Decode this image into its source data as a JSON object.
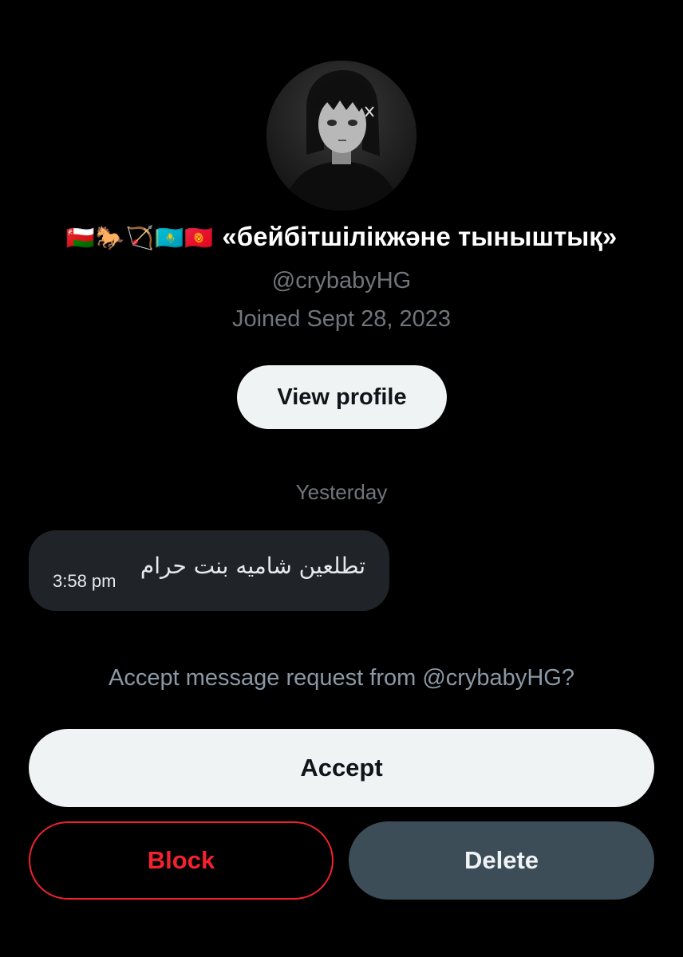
{
  "profile": {
    "avatar_icon": "anime-girl-avatar",
    "flags": "🇴🇲🐎🏹🇰🇿🇰🇬",
    "display_name": "«бейбітшілікжәне тыныштық»",
    "handle": "@crybabyHG",
    "joined": "Joined Sept 28, 2023",
    "view_profile_label": "View profile"
  },
  "conversation": {
    "day_divider": "Yesterday",
    "messages": [
      {
        "text": "تطلعين شاميه بنت حرام",
        "time": "3:58 pm"
      }
    ]
  },
  "request": {
    "prompt": "Accept message request from @crybabyHG?",
    "accept_label": "Accept",
    "block_label": "Block",
    "delete_label": "Delete"
  },
  "colors": {
    "background": "#000000",
    "muted_text": "#71767b",
    "bubble": "#202327",
    "danger": "#f4212e",
    "delete_button": "#3c4d58",
    "light_button": "#eff3f4"
  }
}
